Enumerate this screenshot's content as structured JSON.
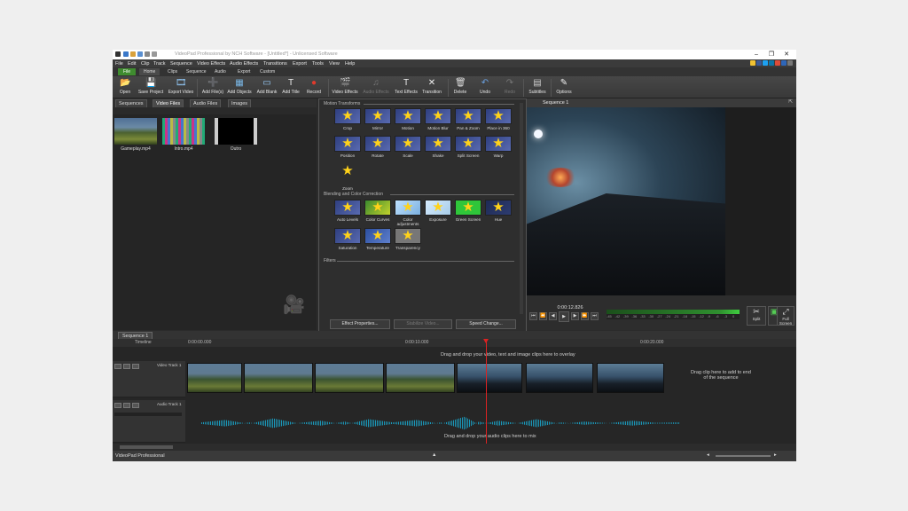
{
  "window": {
    "title": "VideoPad Professional by NCH Software - [Untitled*] - Unlicensed Software",
    "controls": [
      "–",
      "❐",
      "✕"
    ]
  },
  "menu": [
    "File",
    "Edit",
    "Clip",
    "Track",
    "Sequence",
    "Video Effects",
    "Audio Effects",
    "Transitions",
    "Export",
    "Tools",
    "View",
    "Help"
  ],
  "ribbon_tabs": [
    "File",
    "Home",
    "Clips",
    "Sequence",
    "Audio",
    "Export",
    "Custom"
  ],
  "toolbar": [
    {
      "label": "Open",
      "icon": "folder-icon",
      "glyph": "📂"
    },
    {
      "label": "Save Project",
      "icon": "floppy-icon",
      "glyph": "💾"
    },
    {
      "label": "Export Video",
      "icon": "export-icon",
      "glyph": "🎞"
    },
    {
      "label": "Add File(s)",
      "icon": "add-file-icon",
      "glyph": "➕"
    },
    {
      "label": "Add Objects",
      "icon": "add-objects-icon",
      "glyph": "▦"
    },
    {
      "label": "Add Blank",
      "icon": "add-blank-icon",
      "glyph": "▭"
    },
    {
      "label": "Add Title",
      "icon": "title-icon",
      "glyph": "T"
    },
    {
      "label": "Record",
      "icon": "record-icon",
      "glyph": "●"
    },
    {
      "label": "Video Effects",
      "icon": "video-effects-icon",
      "glyph": "🎬"
    },
    {
      "label": "Audio Effects",
      "icon": "audio-effects-icon",
      "glyph": "♫"
    },
    {
      "label": "Text Effects",
      "icon": "text-effects-icon",
      "glyph": "T"
    },
    {
      "label": "Transition",
      "icon": "transition-icon",
      "glyph": "✕"
    },
    {
      "label": "Delete",
      "icon": "trash-icon",
      "glyph": "🗑"
    },
    {
      "label": "Undo",
      "icon": "undo-icon",
      "glyph": "↶"
    },
    {
      "label": "Redo",
      "icon": "redo-icon",
      "glyph": "↷"
    },
    {
      "label": "Subtitles",
      "icon": "subtitles-icon",
      "glyph": "▤"
    },
    {
      "label": "Options",
      "icon": "options-icon",
      "glyph": "✎"
    }
  ],
  "bin": {
    "tabs": [
      "Sequences",
      "Video Files",
      "Audio Files",
      "Images"
    ],
    "files": [
      {
        "name": "Gameplay.mp4"
      },
      {
        "name": "Intro.mp4"
      },
      {
        "name": "Outro"
      }
    ]
  },
  "effects": {
    "sections": [
      "Motion Transforms",
      "Blending and Color Correction",
      "Filters"
    ],
    "motion": [
      "Crop",
      "Mirror",
      "Motion",
      "Motion Blur",
      "Pan & Zoom",
      "Place in 360",
      "Position",
      "Rotate",
      "Scale",
      "Shake",
      "Split Screen",
      "Warp",
      "Zoom"
    ],
    "blending": [
      "Auto Levels",
      "Color Curves",
      "Color adjustments",
      "Exposure",
      "Green Screen",
      "Hue",
      "Saturation",
      "Temperature",
      "Transparency"
    ],
    "buttons": [
      "Effect Properties...",
      "Stabilize Video...",
      "Speed Change..."
    ]
  },
  "preview": {
    "tab": "Sequence 1",
    "time": "0:00:12.826",
    "level_labels": [
      "-45",
      "-42",
      "-39",
      "-36",
      "-33",
      "-30",
      "-27",
      "-24",
      "-21",
      "-18",
      "-15",
      "-12",
      "-9",
      "-6",
      "-3",
      "0"
    ],
    "buttons": [
      "Split",
      "Unlink",
      "Full Screen"
    ]
  },
  "timeline": {
    "tab": "Sequence 1",
    "label": "Timeline",
    "ruler": [
      "0:00:00.000",
      "0:00:10.000",
      "0:00:20.000"
    ],
    "video_track": "Video Track 1",
    "audio_track": "Audio Track 1",
    "overlay_hint": "Drag and drop your video, text and image clips here to overlay",
    "end_hint": "Drag clip here to add to end of the sequence",
    "audio_hint": "Drag and drop your audio clips here to mix"
  },
  "status": "VideoPad Professional",
  "colors": {
    "accent": "#3f8c2f",
    "playhead": "#dd2222",
    "waveform": "#1a97b8"
  }
}
